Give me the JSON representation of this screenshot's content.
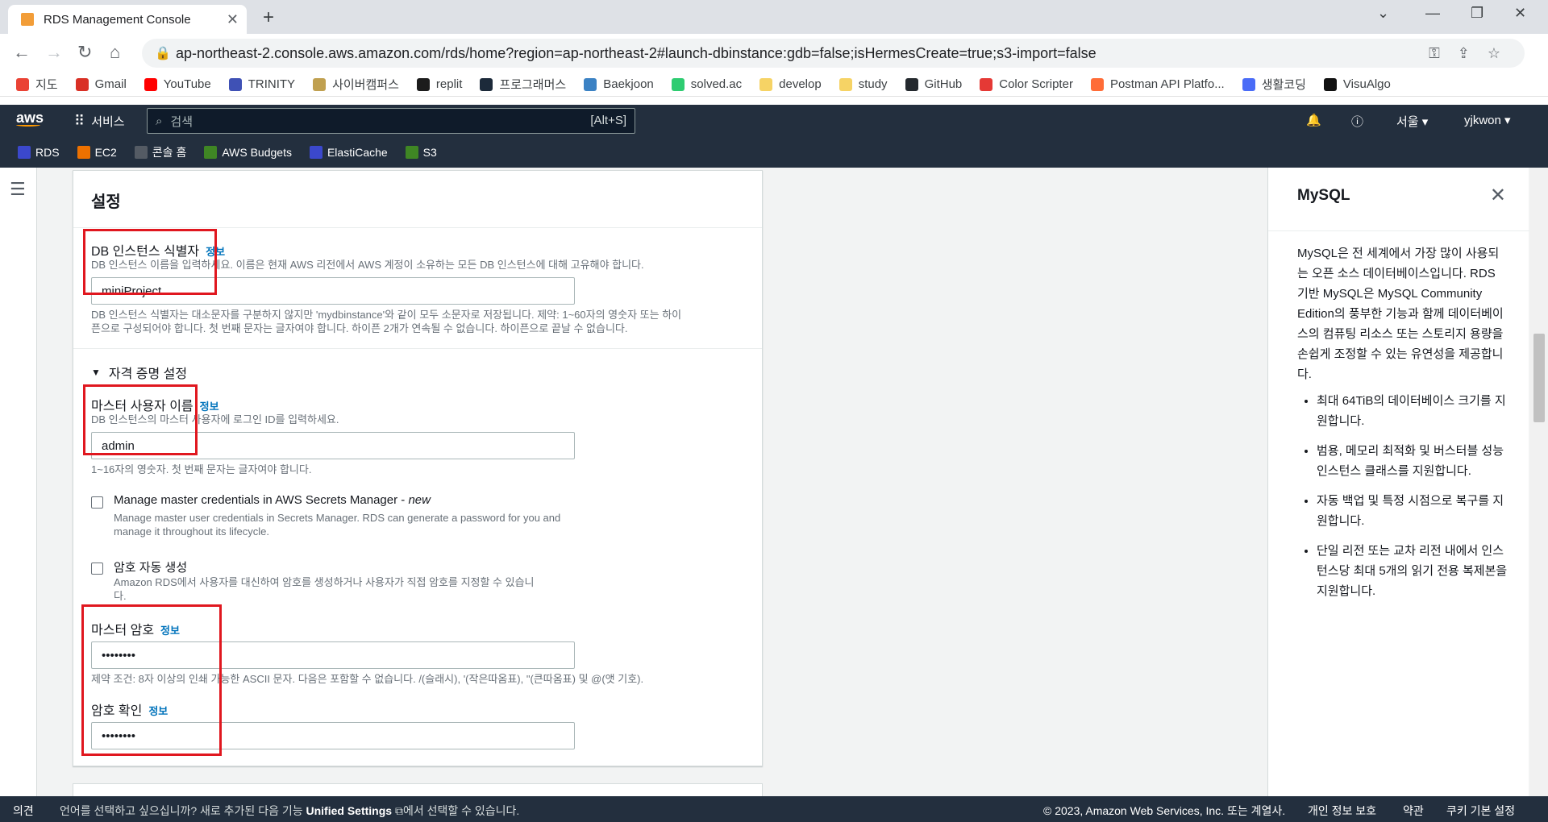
{
  "browser": {
    "tab_title": "RDS Management Console",
    "url": "ap-northeast-2.console.aws.amazon.com/rds/home?region=ap-northeast-2#launch-dbinstance:gdb=false;isHermesCreate=true;s3-import=false",
    "bookmarks": [
      {
        "label": "지도",
        "color": "#ea4335"
      },
      {
        "label": "Gmail",
        "color": "#d93025"
      },
      {
        "label": "YouTube",
        "color": "#ff0000"
      },
      {
        "label": "TRINITY",
        "color": "#3f51b5"
      },
      {
        "label": "사이버캠퍼스",
        "color": "#c0a050"
      },
      {
        "label": "replit",
        "color": "#1c1c1c"
      },
      {
        "label": "프로그래머스",
        "color": "#1c2a3a"
      },
      {
        "label": "Baekjoon",
        "color": "#3b82c4"
      },
      {
        "label": "solved.ac",
        "color": "#2ecc71"
      },
      {
        "label": "develop",
        "color": "#f6d365"
      },
      {
        "label": "study",
        "color": "#f6d365"
      },
      {
        "label": "GitHub",
        "color": "#24292e"
      },
      {
        "label": "Color Scripter",
        "color": "#e53935"
      },
      {
        "label": "Postman API Platfo...",
        "color": "#ff6c37"
      },
      {
        "label": "생활코딩",
        "color": "#4a6cf7"
      },
      {
        "label": "VisuAlgo",
        "color": "#111111"
      }
    ]
  },
  "aws": {
    "services_label": "서비스",
    "search_placeholder": "검색",
    "search_shortcut": "[Alt+S]",
    "region": "서울 ▾",
    "user": "yjkwon ▾",
    "favorites": [
      {
        "label": "RDS",
        "color": "#3b48cc"
      },
      {
        "label": "EC2",
        "color": "#ed7100"
      },
      {
        "label": "콘솔 홈",
        "color": "#545b64"
      },
      {
        "label": "AWS Budgets",
        "color": "#3f8624"
      },
      {
        "label": "ElastiCache",
        "color": "#3b48cc"
      },
      {
        "label": "S3",
        "color": "#3f8624"
      }
    ]
  },
  "settings": {
    "title": "설정",
    "info": "정보",
    "db_identifier": {
      "label": "DB 인스턴스 식별자",
      "desc": "DB 인스턴스 이름을 입력하세요. 이름은 현재 AWS 리전에서 AWS 계정이 소유하는 모든 DB 인스턴스에 대해 고유해야 합니다.",
      "value": "miniProject",
      "constraint1": "DB 인스턴스 식별자는 대소문자를 구분하지 않지만 'mydbinstance'와 같이 모두 소문자로 저장됩니다. 제약: 1~60자의 영숫자 또는 하이",
      "constraint2": "픈으로 구성되어야 합니다. 첫 번째 문자는 글자여야 합니다. 하이픈 2개가 연속될 수 없습니다. 하이픈으로 끝날 수 없습니다."
    },
    "credentials": {
      "section_title": "자격 증명 설정",
      "master_username_label": "마스터 사용자 이름",
      "master_username_desc": "DB 인스턴스의 마스터 사용자에 로그인 ID를 입력하세요.",
      "master_username_value": "admin",
      "master_username_constraint": "1~16자의 영숫자. 첫 번째 문자는 글자여야 합니다.",
      "secrets_label": "Manage master credentials in AWS Secrets Manager - ",
      "secrets_new": "new",
      "secrets_desc1": "Manage master user credentials in Secrets Manager. RDS can generate a password for you and",
      "secrets_desc2": "manage it throughout its lifecycle.",
      "auto_pw_label": "암호 자동 생성",
      "auto_pw_desc1": "Amazon RDS에서 사용자를 대신하여 암호를 생성하거나 사용자가 직접 암호를 지정할 수 있습니",
      "auto_pw_desc2": "다.",
      "master_pw_label": "마스터 암호",
      "master_pw_value": "••••••••",
      "master_pw_constraint": "제약 조건: 8자 이상의 인쇄 가능한 ASCII 문자. 다음은 포함할 수 없습니다. /(슬래시), '(작은따옴표), \"(큰따옴표) 및 @(앳 기호).",
      "confirm_pw_label": "암호 확인",
      "confirm_pw_value": "••••••••"
    }
  },
  "help_panel": {
    "title": "MySQL",
    "intro": "MySQL은 전 세계에서 가장 많이 사용되는 오픈 소스 데이터베이스입니다. RDS 기반 MySQL은 MySQL Community Edition의 풍부한 기능과 함께 데이터베이스의 컴퓨팅 리소스 또는 스토리지 용량을 손쉽게 조정할 수 있는 유연성을 제공합니다.",
    "bullets": [
      "최대 64TiB의 데이터베이스 크기를 지원합니다.",
      "범용, 메모리 최적화 및 버스터블 성능 인스턴스 클래스를 지원합니다.",
      "자동 백업 및 특정 시점으로 복구를 지원합니다.",
      "단일 리전 또는 교차 리전 내에서 인스턴스당 최대 5개의 읽기 전용 복제본을 지원합니다."
    ]
  },
  "footer": {
    "feedback": "의견",
    "lang_msg_a": "언어를 선택하고 싶으십니까? 새로 추가된 다음 기능 ",
    "lang_link": "Unified Settings",
    "lang_msg_b": "에서 선택할 수 있습니다.",
    "copyright": "© 2023, Amazon Web Services, Inc. 또는 계열사.",
    "privacy": "개인 정보 보호",
    "terms": "약관",
    "cookies": "쿠키 기본 설정"
  }
}
